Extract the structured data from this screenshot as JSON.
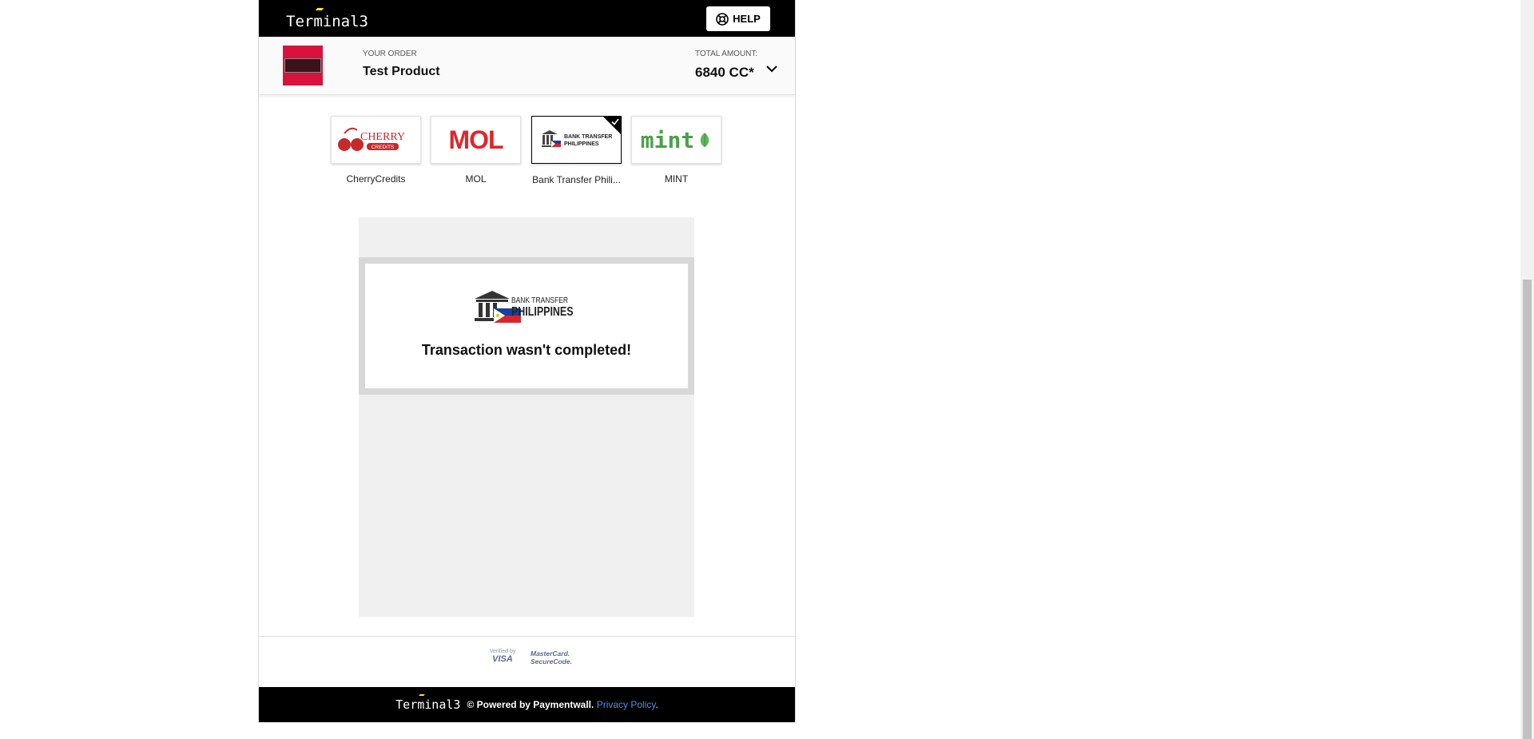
{
  "brand": {
    "name": "Terminal3"
  },
  "header": {
    "help_label": "HELP"
  },
  "order": {
    "your_order_label": "YOUR ORDER",
    "product_name": "Test Product",
    "total_label": "TOTAL AMOUNT:",
    "total_value": "6840 CC*"
  },
  "methods": [
    {
      "label": "CherryCredits",
      "logo_text": "CHERRY",
      "logo_sub": "CREDITS",
      "selected": false
    },
    {
      "label": "MOL",
      "logo_text": "MOL",
      "selected": false
    },
    {
      "label": "Bank Transfer Phili...",
      "logo_text": "BANK TRANSFER",
      "logo_sub": "PHILIPPINES",
      "selected": true
    },
    {
      "label": "MINT",
      "logo_text": "mint",
      "selected": false
    }
  ],
  "payment_frame": {
    "logo_line1": "BANK TRANSFER",
    "logo_line2": "PHILIPPINES",
    "message": "Transaction wasn't completed!"
  },
  "security": {
    "visa_top": "Verified by",
    "visa_bottom": "VISA",
    "mc_top": "MasterCard.",
    "mc_bottom": "SecureCode."
  },
  "footer": {
    "powered_by": "© Powered by Paymentwall.",
    "privacy_link": "Privacy Policy",
    "trailing": "."
  },
  "colors": {
    "accent_yellow": "#ffed00",
    "link_blue": "#4a90e2",
    "brand_black": "#000000"
  }
}
